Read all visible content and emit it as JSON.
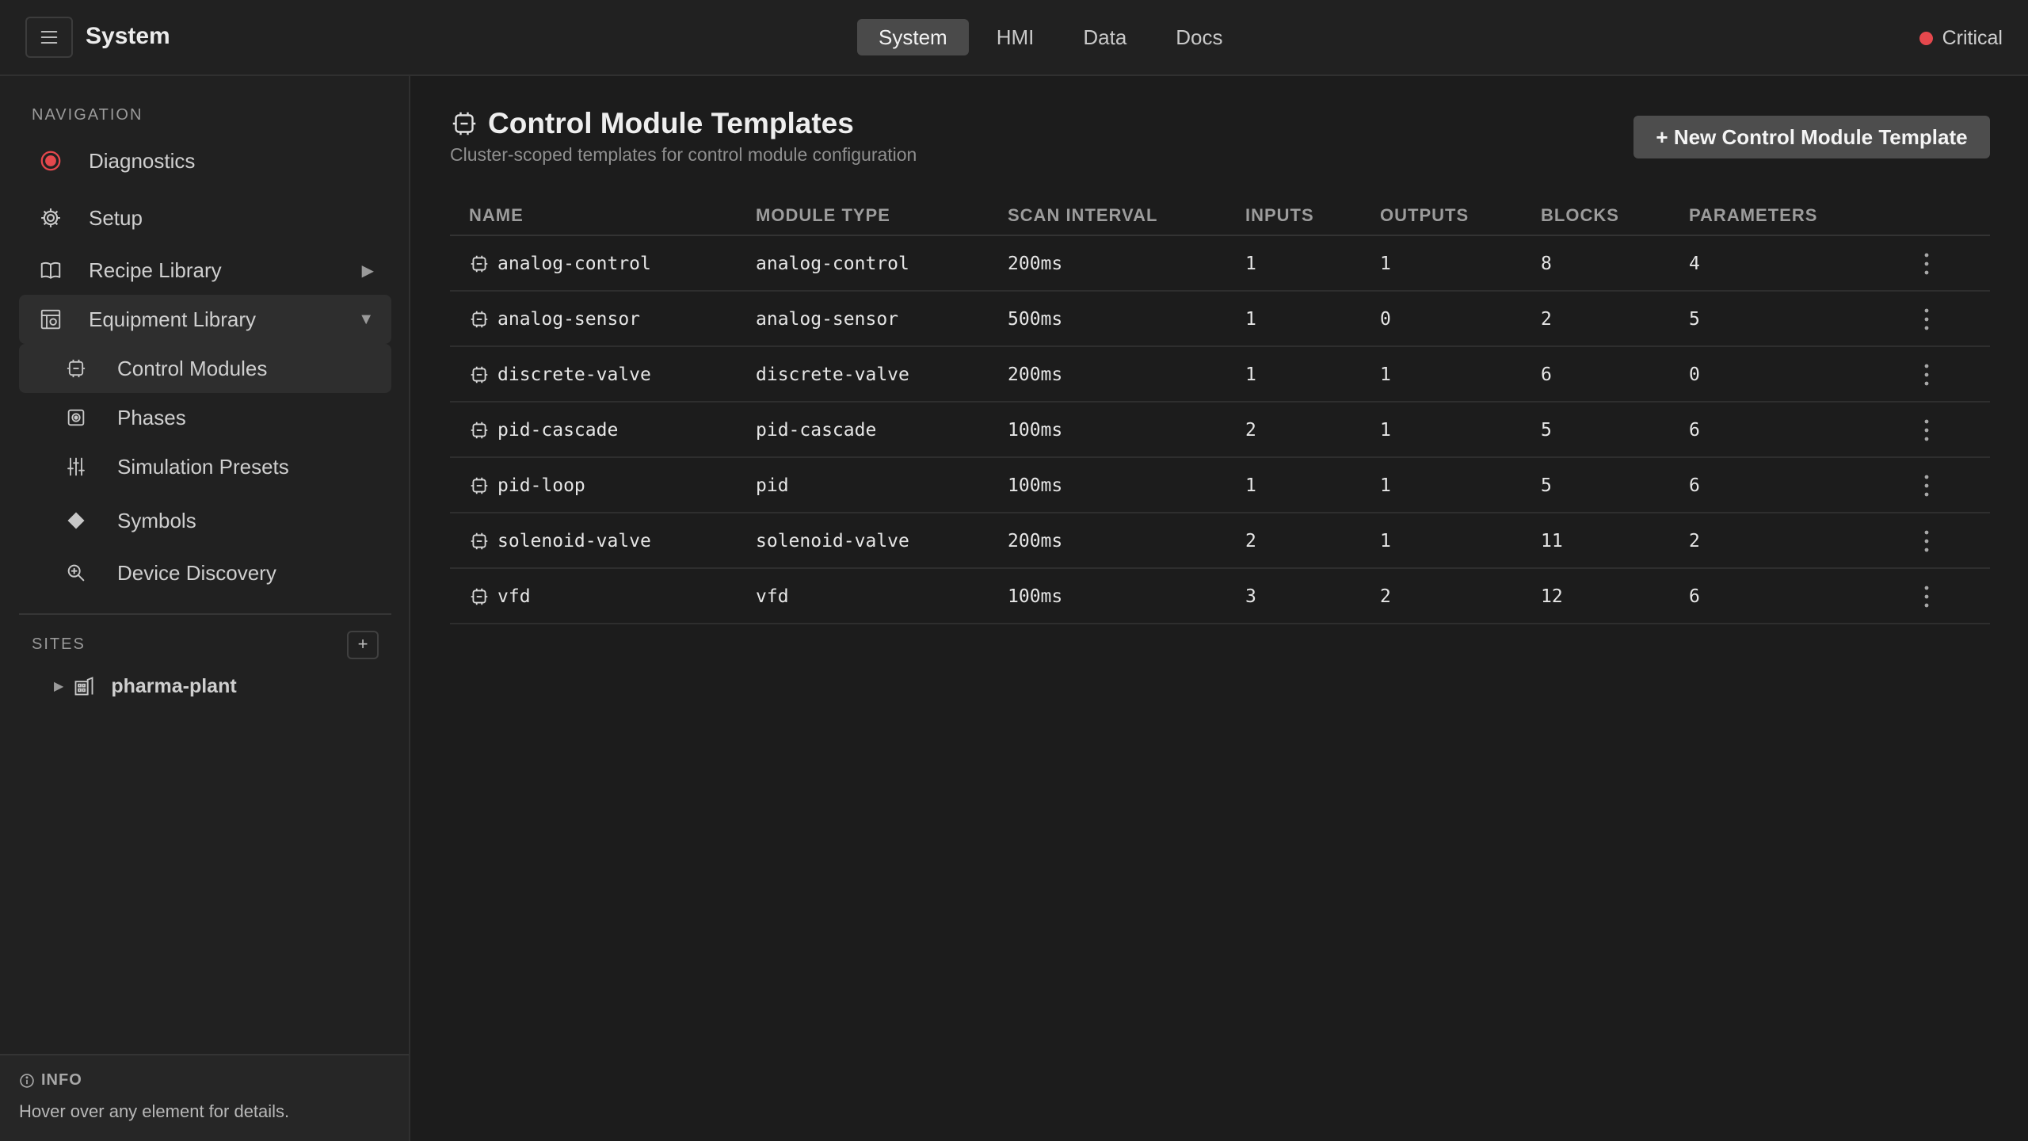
{
  "header": {
    "title": "System",
    "tabs": [
      {
        "label": "System",
        "active": true
      },
      {
        "label": "HMI",
        "active": false
      },
      {
        "label": "Data",
        "active": false
      },
      {
        "label": "Docs",
        "active": false
      }
    ],
    "status": {
      "label": "Critical",
      "color": "#e5484d"
    }
  },
  "sidebar": {
    "nav_heading": "NAVIGATION",
    "items": [
      {
        "label": "Diagnostics",
        "icon": "status-record-icon"
      },
      {
        "label": "Setup",
        "icon": "gear-icon"
      },
      {
        "label": "Recipe Library",
        "icon": "book-icon",
        "expanded": false
      },
      {
        "label": "Equipment Library",
        "icon": "equipment-icon",
        "expanded": true
      }
    ],
    "sub_items": [
      {
        "label": "Control Modules",
        "icon": "chip-icon",
        "selected": true
      },
      {
        "label": "Phases",
        "icon": "phase-icon"
      },
      {
        "label": "Simulation Presets",
        "icon": "sliders-icon"
      },
      {
        "label": "Symbols",
        "icon": "diamond-icon"
      },
      {
        "label": "Device Discovery",
        "icon": "zoom-search-icon"
      }
    ],
    "sites_heading": "SITES",
    "sites_add_label": "+",
    "sites": [
      {
        "label": "pharma-plant",
        "icon": "building-icon"
      }
    ],
    "info": {
      "title": "INFO",
      "text": "Hover over any element for details."
    }
  },
  "main": {
    "title": "Control Module Templates",
    "subtitle": "Cluster-scoped templates for control module configuration",
    "new_button_label": "+ New Control Module Template",
    "table": {
      "columns": [
        "NAME",
        "MODULE TYPE",
        "SCAN INTERVAL",
        "INPUTS",
        "OUTPUTS",
        "BLOCKS",
        "PARAMETERS"
      ],
      "rows": [
        {
          "name": "analog-control",
          "module_type": "analog-control",
          "scan_interval": "200ms",
          "inputs": "1",
          "outputs": "1",
          "blocks": "8",
          "parameters": "4"
        },
        {
          "name": "analog-sensor",
          "module_type": "analog-sensor",
          "scan_interval": "500ms",
          "inputs": "1",
          "outputs": "0",
          "blocks": "2",
          "parameters": "5"
        },
        {
          "name": "discrete-valve",
          "module_type": "discrete-valve",
          "scan_interval": "200ms",
          "inputs": "1",
          "outputs": "1",
          "blocks": "6",
          "parameters": "0"
        },
        {
          "name": "pid-cascade",
          "module_type": "pid-cascade",
          "scan_interval": "100ms",
          "inputs": "2",
          "outputs": "1",
          "blocks": "5",
          "parameters": "6"
        },
        {
          "name": "pid-loop",
          "module_type": "pid",
          "scan_interval": "100ms",
          "inputs": "1",
          "outputs": "1",
          "blocks": "5",
          "parameters": "6"
        },
        {
          "name": "solenoid-valve",
          "module_type": "solenoid-valve",
          "scan_interval": "200ms",
          "inputs": "2",
          "outputs": "1",
          "blocks": "11",
          "parameters": "2"
        },
        {
          "name": "vfd",
          "module_type": "vfd",
          "scan_interval": "100ms",
          "inputs": "3",
          "outputs": "2",
          "blocks": "12",
          "parameters": "6"
        }
      ]
    }
  }
}
